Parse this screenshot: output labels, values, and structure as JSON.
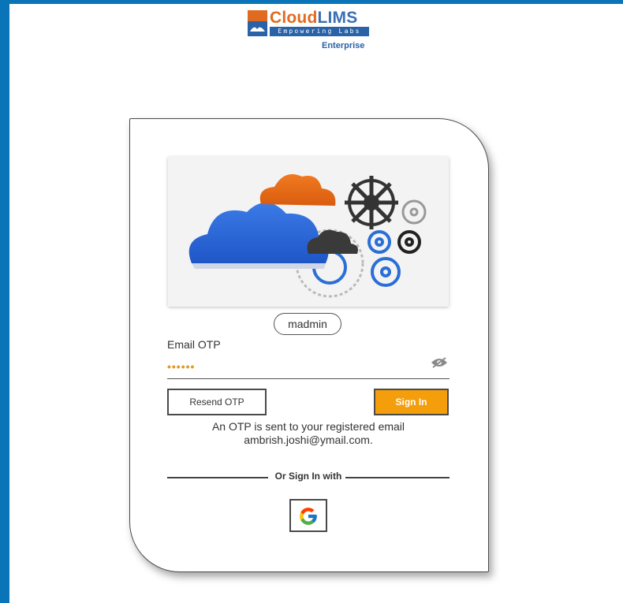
{
  "brand": {
    "name_part1": "Cloud",
    "name_part2": "LIMS",
    "tagline": "Empowering Labs",
    "edition": "Enterprise"
  },
  "login": {
    "username": "madmin",
    "otp_label": "Email OTP",
    "otp_value": "••••••",
    "resend_label": "Resend OTP",
    "signin_label": "Sign In",
    "message_line1": "An OTP is sent to your registered email",
    "message_line2": "ambrish.joshi@ymail.com.",
    "divider_text": "Or Sign In with",
    "google_icon": "google-icon",
    "eye_icon": "eye-hidden-icon"
  },
  "colors": {
    "frame": "#0a74b9",
    "accent": "#f59e0b",
    "otp_text": "#e19a24"
  }
}
